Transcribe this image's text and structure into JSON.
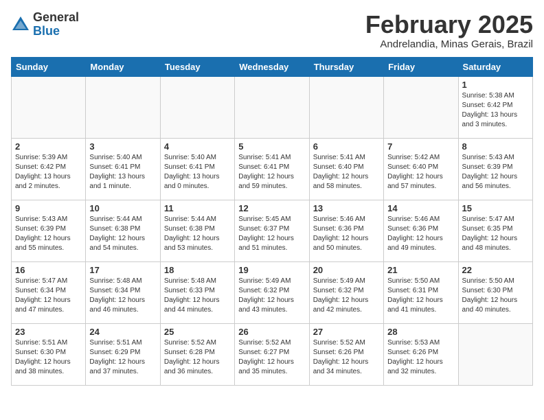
{
  "header": {
    "logo": {
      "general": "General",
      "blue": "Blue"
    },
    "title": "February 2025",
    "subtitle": "Andrelandia, Minas Gerais, Brazil"
  },
  "weekdays": [
    "Sunday",
    "Monday",
    "Tuesday",
    "Wednesday",
    "Thursday",
    "Friday",
    "Saturday"
  ],
  "weeks": [
    [
      {
        "day": "",
        "info": ""
      },
      {
        "day": "",
        "info": ""
      },
      {
        "day": "",
        "info": ""
      },
      {
        "day": "",
        "info": ""
      },
      {
        "day": "",
        "info": ""
      },
      {
        "day": "",
        "info": ""
      },
      {
        "day": "1",
        "info": "Sunrise: 5:38 AM\nSunset: 6:42 PM\nDaylight: 13 hours\nand 3 minutes."
      }
    ],
    [
      {
        "day": "2",
        "info": "Sunrise: 5:39 AM\nSunset: 6:42 PM\nDaylight: 13 hours\nand 2 minutes."
      },
      {
        "day": "3",
        "info": "Sunrise: 5:40 AM\nSunset: 6:41 PM\nDaylight: 13 hours\nand 1 minute."
      },
      {
        "day": "4",
        "info": "Sunrise: 5:40 AM\nSunset: 6:41 PM\nDaylight: 13 hours\nand 0 minutes."
      },
      {
        "day": "5",
        "info": "Sunrise: 5:41 AM\nSunset: 6:41 PM\nDaylight: 12 hours\nand 59 minutes."
      },
      {
        "day": "6",
        "info": "Sunrise: 5:41 AM\nSunset: 6:40 PM\nDaylight: 12 hours\nand 58 minutes."
      },
      {
        "day": "7",
        "info": "Sunrise: 5:42 AM\nSunset: 6:40 PM\nDaylight: 12 hours\nand 57 minutes."
      },
      {
        "day": "8",
        "info": "Sunrise: 5:43 AM\nSunset: 6:39 PM\nDaylight: 12 hours\nand 56 minutes."
      }
    ],
    [
      {
        "day": "9",
        "info": "Sunrise: 5:43 AM\nSunset: 6:39 PM\nDaylight: 12 hours\nand 55 minutes."
      },
      {
        "day": "10",
        "info": "Sunrise: 5:44 AM\nSunset: 6:38 PM\nDaylight: 12 hours\nand 54 minutes."
      },
      {
        "day": "11",
        "info": "Sunrise: 5:44 AM\nSunset: 6:38 PM\nDaylight: 12 hours\nand 53 minutes."
      },
      {
        "day": "12",
        "info": "Sunrise: 5:45 AM\nSunset: 6:37 PM\nDaylight: 12 hours\nand 51 minutes."
      },
      {
        "day": "13",
        "info": "Sunrise: 5:46 AM\nSunset: 6:36 PM\nDaylight: 12 hours\nand 50 minutes."
      },
      {
        "day": "14",
        "info": "Sunrise: 5:46 AM\nSunset: 6:36 PM\nDaylight: 12 hours\nand 49 minutes."
      },
      {
        "day": "15",
        "info": "Sunrise: 5:47 AM\nSunset: 6:35 PM\nDaylight: 12 hours\nand 48 minutes."
      }
    ],
    [
      {
        "day": "16",
        "info": "Sunrise: 5:47 AM\nSunset: 6:34 PM\nDaylight: 12 hours\nand 47 minutes."
      },
      {
        "day": "17",
        "info": "Sunrise: 5:48 AM\nSunset: 6:34 PM\nDaylight: 12 hours\nand 46 minutes."
      },
      {
        "day": "18",
        "info": "Sunrise: 5:48 AM\nSunset: 6:33 PM\nDaylight: 12 hours\nand 44 minutes."
      },
      {
        "day": "19",
        "info": "Sunrise: 5:49 AM\nSunset: 6:32 PM\nDaylight: 12 hours\nand 43 minutes."
      },
      {
        "day": "20",
        "info": "Sunrise: 5:49 AM\nSunset: 6:32 PM\nDaylight: 12 hours\nand 42 minutes."
      },
      {
        "day": "21",
        "info": "Sunrise: 5:50 AM\nSunset: 6:31 PM\nDaylight: 12 hours\nand 41 minutes."
      },
      {
        "day": "22",
        "info": "Sunrise: 5:50 AM\nSunset: 6:30 PM\nDaylight: 12 hours\nand 40 minutes."
      }
    ],
    [
      {
        "day": "23",
        "info": "Sunrise: 5:51 AM\nSunset: 6:30 PM\nDaylight: 12 hours\nand 38 minutes."
      },
      {
        "day": "24",
        "info": "Sunrise: 5:51 AM\nSunset: 6:29 PM\nDaylight: 12 hours\nand 37 minutes."
      },
      {
        "day": "25",
        "info": "Sunrise: 5:52 AM\nSunset: 6:28 PM\nDaylight: 12 hours\nand 36 minutes."
      },
      {
        "day": "26",
        "info": "Sunrise: 5:52 AM\nSunset: 6:27 PM\nDaylight: 12 hours\nand 35 minutes."
      },
      {
        "day": "27",
        "info": "Sunrise: 5:52 AM\nSunset: 6:26 PM\nDaylight: 12 hours\nand 34 minutes."
      },
      {
        "day": "28",
        "info": "Sunrise: 5:53 AM\nSunset: 6:26 PM\nDaylight: 12 hours\nand 32 minutes."
      },
      {
        "day": "",
        "info": ""
      }
    ]
  ]
}
